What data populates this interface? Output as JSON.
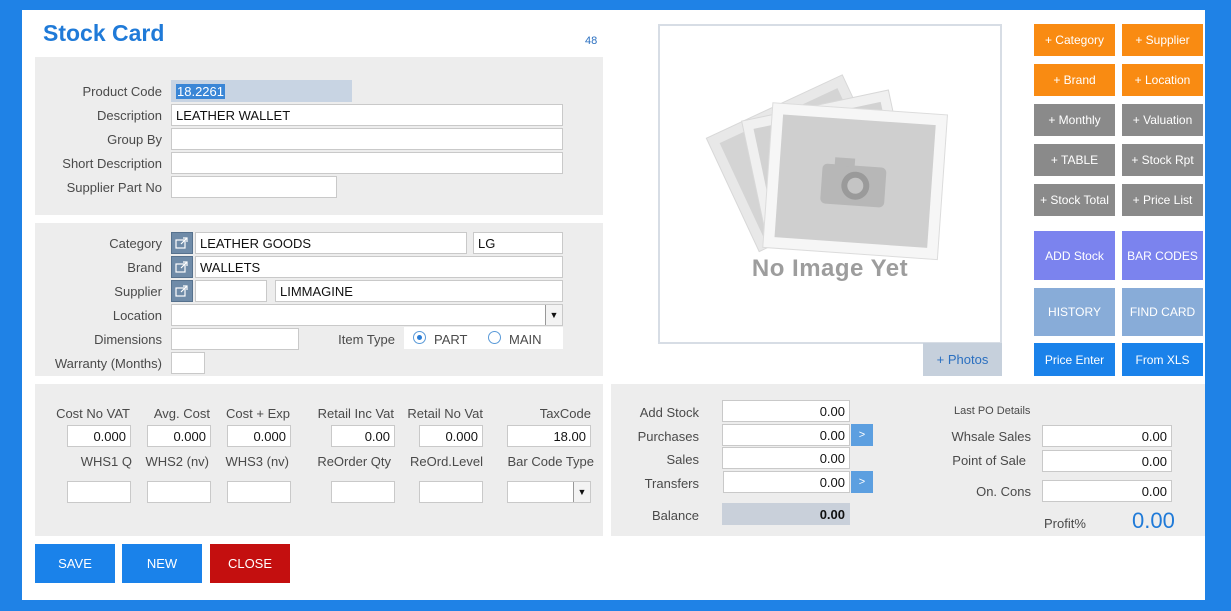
{
  "form": {
    "title": "Stock Card",
    "record_count": "48"
  },
  "product": {
    "code_label": "Product Code",
    "code": "18.2261",
    "description_label": "Description",
    "description": "LEATHER WALLET",
    "group_by_label": "Group By",
    "group_by": "",
    "short_desc_label": "Short Description",
    "short_desc": "",
    "supplier_part_label": "Supplier Part No",
    "supplier_part": ""
  },
  "classification": {
    "category_label": "Category",
    "category": "LEATHER GOODS",
    "category_code": "LG",
    "brand_label": "Brand",
    "brand": "WALLETS",
    "supplier_label": "Supplier",
    "supplier_code": "",
    "supplier": "LIMMAGINE",
    "location_label": "Location",
    "location": "",
    "dimensions_label": "Dimensions",
    "dimensions": "",
    "item_type_label": "Item Type",
    "item_type_options": [
      "PART",
      "MAIN"
    ],
    "item_type_selected": "PART",
    "warranty_label": "Warranty (Months)",
    "warranty": ""
  },
  "pricing": {
    "row1_labels": [
      "Cost No VAT",
      "Avg. Cost",
      "Cost + Exp",
      "Retail Inc Vat",
      "Retail No Vat",
      "TaxCode"
    ],
    "row1_values": [
      "0.000",
      "0.000",
      "0.000",
      "0.00",
      "0.000",
      "18.00"
    ],
    "row2_labels": [
      "WHS1 Q",
      "WHS2 (nv)",
      "WHS3 (nv)",
      "ReOrder Qty",
      "ReOrd.Level",
      "Bar Code Type"
    ],
    "row2_values": [
      "",
      "",
      "",
      "",
      "",
      ""
    ]
  },
  "stock": {
    "add_stock_label": "Add Stock",
    "add_stock": "0.00",
    "purchases_label": "Purchases",
    "purchases": "0.00",
    "sales_label": "Sales",
    "sales": "0.00",
    "transfers_label": "Transfers",
    "transfers": "0.00",
    "balance_label": "Balance",
    "balance": "0.00",
    "arrow": ">"
  },
  "po": {
    "heading": "Last PO Details",
    "whsale_label": "Whsale Sales",
    "whsale": "0.00",
    "pos_label": "Point of Sale",
    "pos": "0.00",
    "oncons_label": "On. Cons",
    "oncons": "0.00",
    "profit_label": "Profit%",
    "profit": "0.00"
  },
  "image": {
    "placeholder_text": "No Image Yet",
    "photos_button": "+ Photos"
  },
  "side_buttons": {
    "category": "+ Category",
    "supplier": "+ Supplier",
    "brand": "+ Brand",
    "location": "+ Location",
    "monthly": "+ Monthly",
    "valuation": "+ Valuation",
    "table": "+ TABLE",
    "stock_rpt": "+ Stock Rpt",
    "stock_total": "+ Stock Total",
    "price_list": "+ Price List",
    "add_stock": "ADD Stock",
    "bar_codes": "BAR CODES",
    "history": "HISTORY",
    "find_card": "FIND CARD",
    "price_enter": "Price Enter",
    "from_xls": "From XLS"
  },
  "actions": {
    "save": "SAVE",
    "new": "NEW",
    "close": "CLOSE"
  },
  "colors": {
    "frame": "#1f82e6",
    "accent_orange": "#f98b12",
    "accent_gray": "#8a8a8a",
    "accent_purple": "#7b83ee",
    "accent_steel": "#88acd8",
    "accent_blue": "#1a82ea",
    "danger_red": "#c40f0f"
  }
}
